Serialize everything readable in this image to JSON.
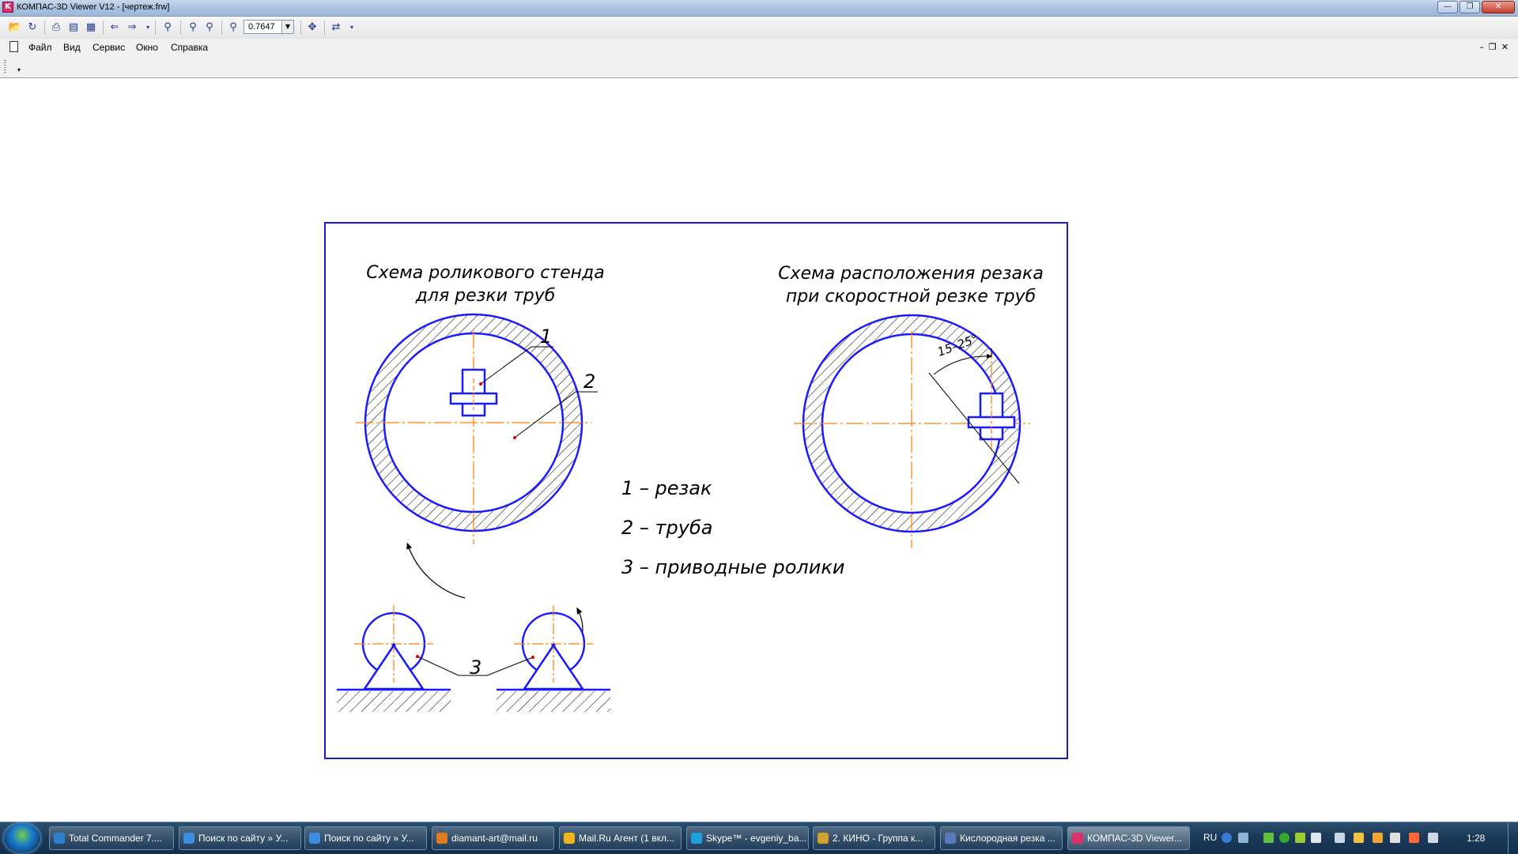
{
  "window": {
    "title": "КОМПАС-3D Viewer V12 - [чертеж.frw]",
    "app_icon": "kompas-icon"
  },
  "toolbar": {
    "zoom_value": "0.7647",
    "icons": [
      "open-icon",
      "save-icon",
      "print-icon",
      "preview-icon",
      "page-setup-icon",
      "back-icon",
      "forward-icon",
      "zoom-window-icon",
      "zoom-in-icon",
      "zoom-out-icon",
      "zoom-all-icon",
      "pan-icon",
      "refresh-icon"
    ]
  },
  "menu": {
    "items": [
      "Файл",
      "Вид",
      "Сервис",
      "Окно",
      "Справка"
    ]
  },
  "drawing": {
    "left_title_line1": "Схема роликового стенда",
    "left_title_line2": "для резки труб",
    "right_title_line1": "Схема расположения резака",
    "right_title_line2": "при скоростной резке труб",
    "callout_1": "1",
    "callout_2": "2",
    "callout_3": "3",
    "legend_1": "1 – резак",
    "legend_2": "2 – труба",
    "legend_3": "3 – приводные ролики",
    "angle_label": "15–25°",
    "colors": {
      "outline": "#1a1aff",
      "centerline": "#ff7f00",
      "hatch": "#000000",
      "frame": "#1a1acc"
    }
  },
  "taskbar": {
    "tasks": [
      {
        "label": "Total Commander 7....",
        "color": "#2d7fd0"
      },
      {
        "label": "Поиск по сайту » У...",
        "color": "#3b8de0"
      },
      {
        "label": "Поиск по сайту » У...",
        "color": "#3b8de0"
      },
      {
        "label": "diamant-art@mail.ru",
        "color": "#e07b1f"
      },
      {
        "label": "Mail.Ru Агент (1 вкл...",
        "color": "#f0b41e"
      },
      {
        "label": "Skype™ - evgeniy_ba...",
        "color": "#1ea0e0"
      },
      {
        "label": "2. КИНО - Группа к...",
        "color": "#d0a030"
      },
      {
        "label": "Кислородная резка ...",
        "color": "#5a7ac0"
      },
      {
        "label": "КОМПАС-3D Viewer...",
        "color": "#d8336a"
      }
    ],
    "language": "RU",
    "time": "1:28"
  }
}
